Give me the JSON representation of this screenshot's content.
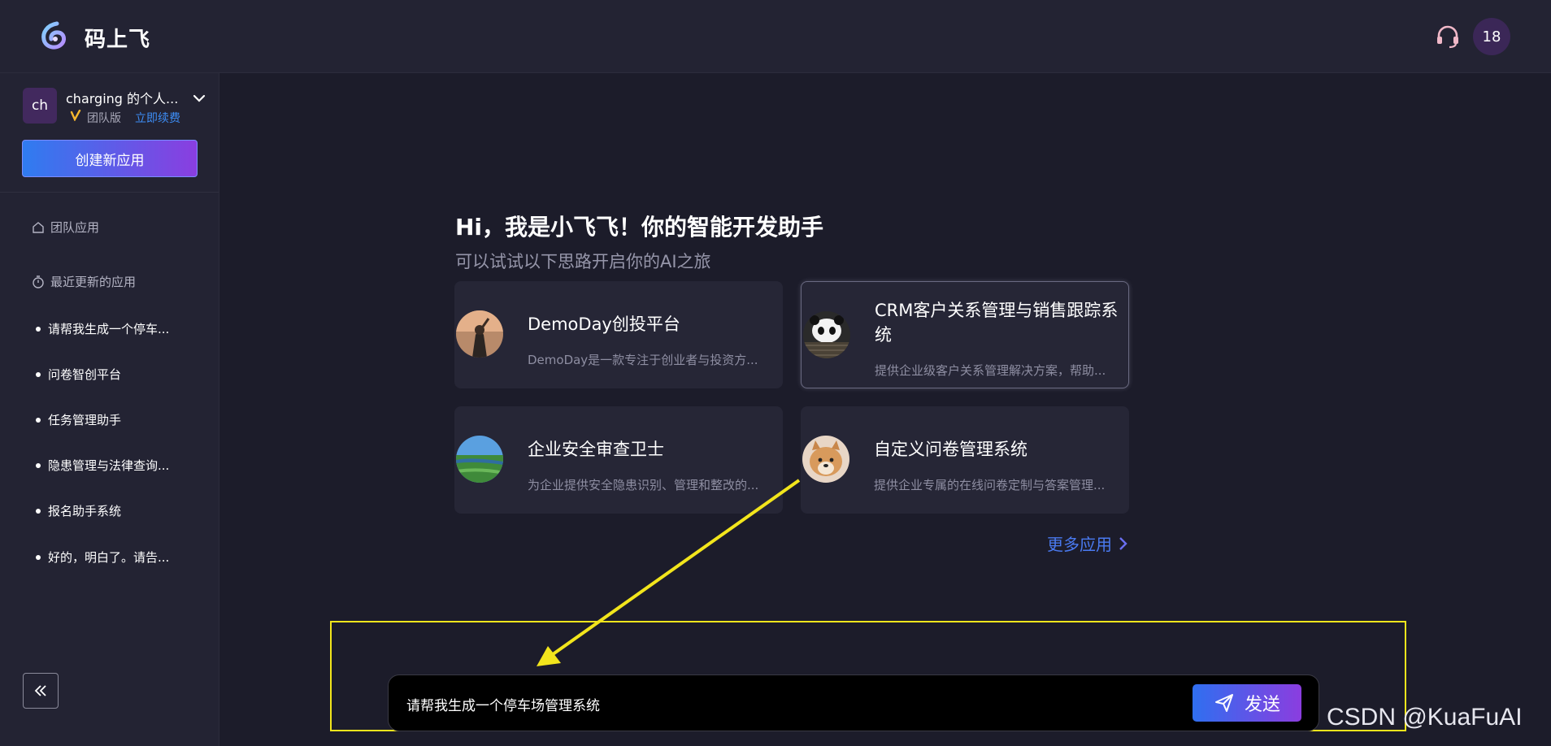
{
  "app": {
    "name": "码上飞",
    "notification_count": "18"
  },
  "team": {
    "avatar_text": "ch",
    "name": "charging 的个人...",
    "plan": "团队版",
    "renew_label": "立即续费"
  },
  "sidebar": {
    "create_button": "创建新应用",
    "team_apps_label": "团队应用",
    "recent_label": "最近更新的应用",
    "recent_items": [
      "请帮我生成一个停车...",
      "问卷智创平台",
      "任务管理助手",
      "隐患管理与法律查询...",
      "报名助手系统",
      "好的，明白了。请告..."
    ]
  },
  "main": {
    "greeting": "Hi，我是小飞飞！你的智能开发助手",
    "subtitle": "可以试试以下思路开启你的AI之旅",
    "cards": [
      {
        "title": "DemoDay创投平台",
        "desc": "DemoDay是一款专注于创业者与投资方..."
      },
      {
        "title": "CRM客户关系管理与销售跟踪系统",
        "desc": "提供企业级客户关系管理解决方案，帮助..."
      },
      {
        "title": "企业安全审查卫士",
        "desc": "为企业提供安全隐患识别、管理和整改的..."
      },
      {
        "title": "自定义问卷管理系统",
        "desc": "提供企业专属的在线问卷定制与答案管理..."
      }
    ],
    "more_link": "更多应用"
  },
  "input": {
    "value": "请帮我生成一个停车场管理系统",
    "send_label": "发送"
  },
  "watermark": "CSDN @KuaFuAI",
  "colors": {
    "background": "#1c1c2a",
    "panel": "#232333",
    "accent_blue": "#2f7cf0",
    "accent_purple": "#8a3ee0",
    "annotation": "#f2e51c"
  }
}
